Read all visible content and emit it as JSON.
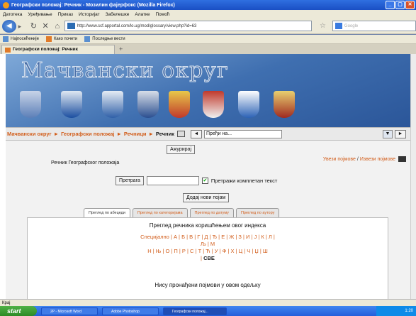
{
  "window": {
    "title": "Географски положај: Речник - Мозилин фајерфокс (Mozilla Firefox)"
  },
  "menu": [
    "Датотека",
    "Уређивање",
    "Приказ",
    "Историјат",
    "Забелешке",
    "Алатке",
    "Помоћ"
  ],
  "nav": {
    "url": "http://www.scf.apportal.com/lo.ug/mod/glossary/view.php?id=63",
    "search_placeholder": "Google"
  },
  "bookmarks": [
    "Најпосећеније",
    "Како почети",
    "Последње вести"
  ],
  "tab": {
    "title": "Географски положај: Речник"
  },
  "site": {
    "banner_title": "Мачвански округ",
    "breadcrumb": [
      "Мачвански округ",
      "Географски положај",
      "Речници",
      "Речник"
    ],
    "jump_placeholder": "Пређи на...",
    "update_label": "Ажурирај",
    "description": "Речник Географског положаја",
    "import_label": "Увези појмове",
    "export_label": "Извези појмове",
    "search_button": "Претрага",
    "fulltext_label": "Претражи комплетан текст",
    "add_entry_label": "Додај нови појам",
    "browse_tabs": [
      "Преглед по абецеди",
      "Преглед по категоријама",
      "Преглед по датуму",
      "Преглед по аутору"
    ],
    "panel_title": "Преглед речника коришћењем овог индекса",
    "letters_line1": "Специјално | А | Б | В | Г | Д | Ђ | Е | Ж | З | И | Ј | К | Л | Љ | М",
    "letters_line2": "Н | Њ | О | П | Р | С | Т | Ћ | У | Ф | Х | Ц | Ч | Џ | Ш",
    "letters_all": "СВЕ",
    "no_entries": "Нису пронађени појмови у овом одељку"
  },
  "status": {
    "text": "Крај"
  },
  "taskbar": {
    "start": "start",
    "tasks": [
      "2P - Microsoft Word",
      "Adobe Photoshop",
      "Географски положај..."
    ],
    "clock": "1:20"
  }
}
